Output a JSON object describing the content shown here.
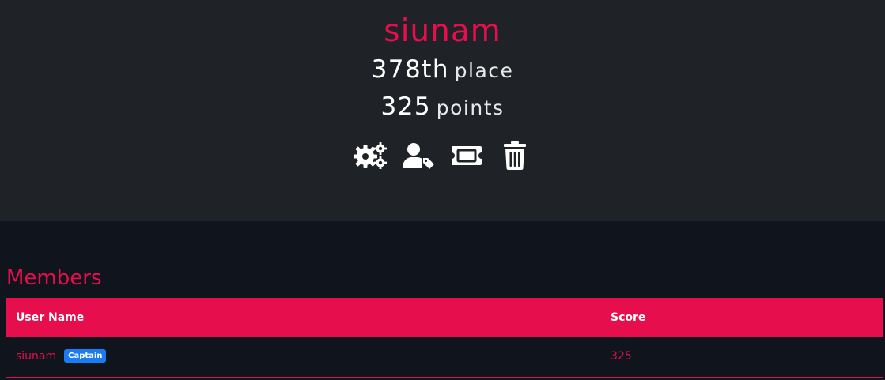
{
  "team": {
    "name": "siunam",
    "place_value": "378th",
    "place_label": "place",
    "points_value": "325",
    "points_label": "points"
  },
  "actions": [
    {
      "icon": "gears-icon",
      "label": "Settings"
    },
    {
      "icon": "user-tag-icon",
      "label": "Captain"
    },
    {
      "icon": "ticket-icon",
      "label": "Invite"
    },
    {
      "icon": "trash-icon",
      "label": "Disband"
    }
  ],
  "members": {
    "title": "Members",
    "columns": [
      "User Name",
      "Score"
    ],
    "rows": [
      {
        "user": "siunam",
        "badge": "Captain",
        "score": "325"
      }
    ]
  },
  "colors": {
    "accent": "#e60e4c",
    "hero_bg": "#1f2226",
    "page_bg": "#10141d",
    "badge": "#1a7cf3"
  }
}
